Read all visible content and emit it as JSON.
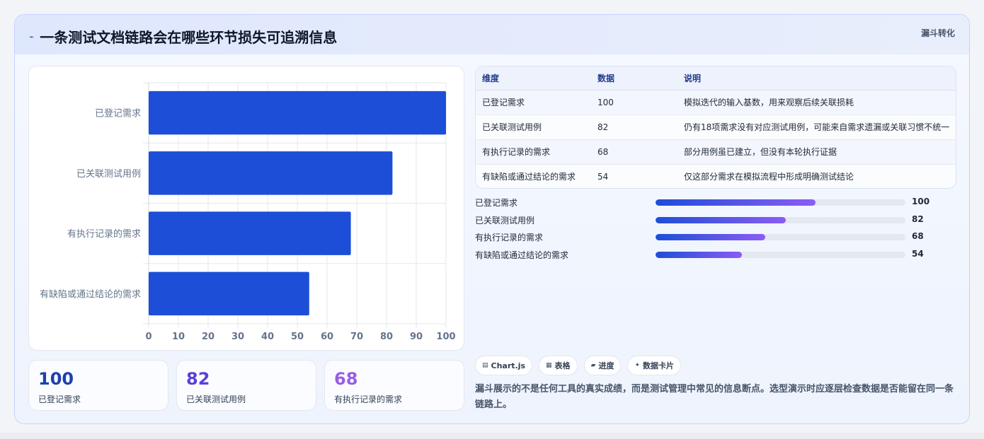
{
  "header": {
    "icon": "chart-line-icon",
    "title": "一条测试文档链路会在哪些环节损失可追溯信息",
    "tag": "漏斗转化"
  },
  "chart_data": {
    "type": "bar",
    "orientation": "horizontal",
    "categories": [
      "已登记需求",
      "已关联测试用例",
      "有执行记录的需求",
      "有缺陷或通过结论的需求"
    ],
    "values": [
      100,
      82,
      68,
      54
    ],
    "xlim": [
      0,
      100
    ],
    "xticks": [
      0,
      10,
      20,
      30,
      40,
      50,
      60,
      70,
      80,
      90,
      100
    ],
    "grid": true,
    "bar_color": "#1d4ed8"
  },
  "stats": [
    {
      "value": "100",
      "label": "已登记需求",
      "color": "#1e40af"
    },
    {
      "value": "82",
      "label": "已关联测试用例",
      "color": "#5b3fd6"
    },
    {
      "value": "68",
      "label": "有执行记录的需求",
      "color": "#9b5de5"
    }
  ],
  "table": {
    "headers": [
      "维度",
      "数据",
      "说明"
    ],
    "rows": [
      [
        "已登记需求",
        "100",
        "模拟迭代的输入基数，用来观察后续关联损耗"
      ],
      [
        "已关联测试用例",
        "82",
        "仍有18项需求没有对应测试用例，可能来自需求遗漏或关联习惯不统一"
      ],
      [
        "有执行记录的需求",
        "68",
        "部分用例虽已建立，但没有本轮执行证据"
      ],
      [
        "有缺陷或通过结论的需求",
        "54",
        "仅这部分需求在模拟流程中形成明确测试结论"
      ]
    ]
  },
  "progress": [
    {
      "label": "已登记需求",
      "value": "100",
      "fill": 0.64
    },
    {
      "label": "已关联测试用例",
      "value": "82",
      "fill": 0.52
    },
    {
      "label": "有执行记录的需求",
      "value": "68",
      "fill": 0.44
    },
    {
      "label": "有缺陷或通过结论的需求",
      "value": "54",
      "fill": 0.345
    }
  ],
  "chips": [
    {
      "icon": "chart-icon",
      "glyph": "▤",
      "label": "Chart.js"
    },
    {
      "icon": "table-icon",
      "glyph": "▦",
      "label": "表格"
    },
    {
      "icon": "progress-icon",
      "glyph": "▰",
      "label": "进度"
    },
    {
      "icon": "sparkle-icon",
      "glyph": "✦",
      "label": "数据卡片"
    }
  ],
  "note": "漏斗展示的不是任何工具的真实成绩，而是测试管理中常见的信息断点。选型演示时应逐层检查数据是否能留在同一条链路上。"
}
